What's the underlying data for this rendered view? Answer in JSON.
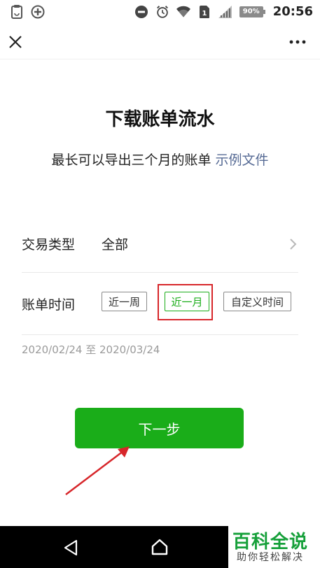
{
  "status_bar": {
    "time": "20:56",
    "battery": "90%",
    "sim_slot": "1",
    "icons": [
      "clipboard-icon",
      "plus-circle-icon",
      "do-not-disturb-icon",
      "alarm-icon",
      "wifi-icon",
      "sim-icon",
      "signal-icon",
      "battery-icon"
    ]
  },
  "nav": {
    "close_icon": "close-icon",
    "more_icon": "more-icon"
  },
  "page": {
    "title": "下载账单流水",
    "subtitle": "最长可以导出三个月的账单",
    "sample_link": "示例文件"
  },
  "transaction_type": {
    "label": "交易类型",
    "value": "全部"
  },
  "bill_time": {
    "label": "账单时间",
    "options": [
      "近一周",
      "近一月",
      "自定义时间"
    ],
    "selected": "近一月",
    "range": "2020/02/24 至 2020/03/24"
  },
  "next_button": {
    "label": "下一步"
  },
  "watermark": {
    "title": "百科全说",
    "subtitle": "助你轻松解决"
  },
  "colors": {
    "accent": "#1aad19",
    "link": "#576b95",
    "highlight": "#d7262a"
  }
}
